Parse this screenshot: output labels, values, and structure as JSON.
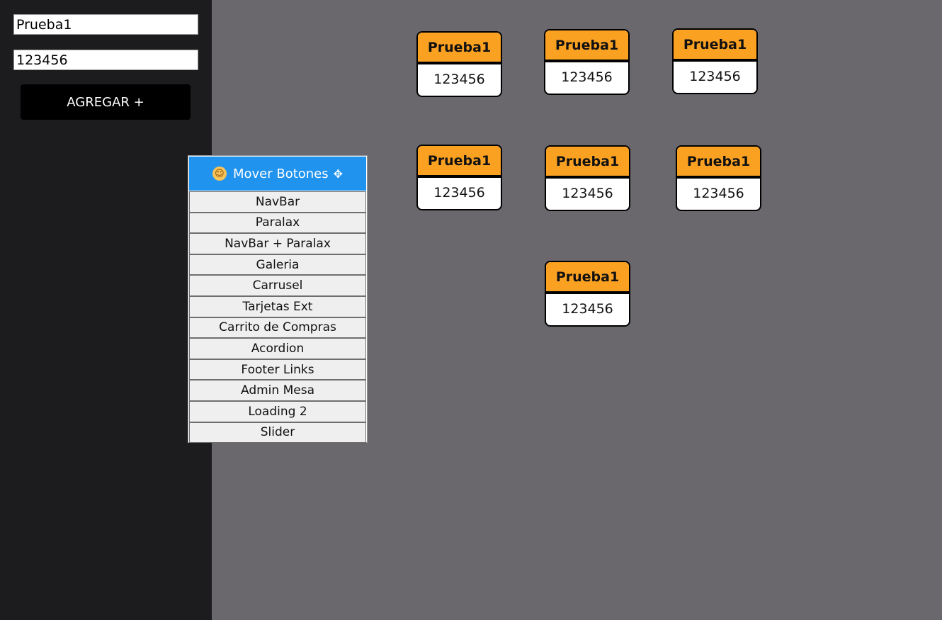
{
  "form": {
    "name_value": "Prueba1",
    "number_value": "123456",
    "add_button_label": "AGREGAR +"
  },
  "mover": {
    "title": "Mover Botones",
    "smiley_icon": "smiley-icon",
    "move_icon": "move-arrows-icon",
    "items": [
      "NavBar",
      "Paralax",
      "NavBar + Paralax",
      "Galeria",
      "Carrusel",
      "Tarjetas Ext",
      "Carrito de Compras",
      "Acordion",
      "Footer Links",
      "Admin Mesa",
      "Loading 2",
      "Slider"
    ]
  },
  "cards": [
    {
      "title": "Prueba1",
      "value": "123456"
    },
    {
      "title": "Prueba1",
      "value": "123456"
    },
    {
      "title": "Prueba1",
      "value": "123456"
    },
    {
      "title": "Prueba1",
      "value": "123456"
    },
    {
      "title": "Prueba1",
      "value": "123456"
    },
    {
      "title": "Prueba1",
      "value": "123456"
    },
    {
      "title": "Prueba1",
      "value": "123456"
    }
  ],
  "colors": {
    "canvas": "#6a686c",
    "sidebar": "#1c1b1d",
    "card_header": "#fba122",
    "mover_header": "#1f93ee"
  }
}
